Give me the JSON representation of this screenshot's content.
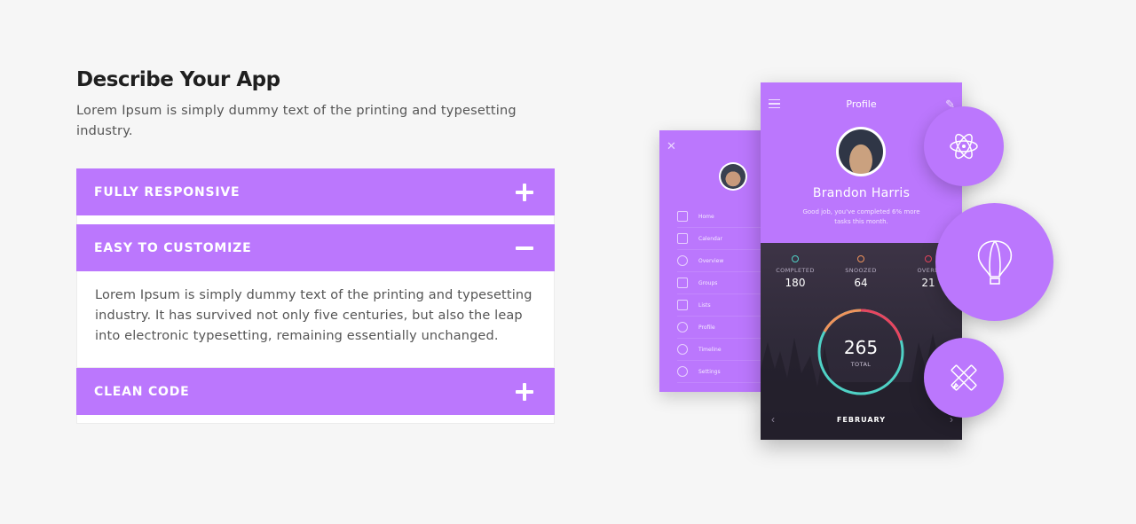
{
  "section": {
    "title": "Describe Your App",
    "description": "Lorem Ipsum is simply dummy text of the printing and typesetting industry."
  },
  "accordion": {
    "items": [
      {
        "label": "FULLY RESPONSIVE",
        "state": "collapsed"
      },
      {
        "label": "EASY TO CUSTOMIZE",
        "state": "expanded",
        "body": "Lorem Ipsum is simply dummy text of the printing and typesetting industry. It has survived not only five centuries, but also the leap into electronic typesetting, remaining essentially unchanged."
      },
      {
        "label": "CLEAN CODE",
        "state": "collapsed"
      }
    ]
  },
  "mockup": {
    "sidebar": {
      "items": [
        "Home",
        "Calendar",
        "Overview",
        "Groups",
        "Lists",
        "Profile",
        "Timeline",
        "Settings"
      ]
    },
    "profile": {
      "title": "Profile",
      "name": "Brandon Harris",
      "subtitle": "Good job, you've completed 6% more tasks this month."
    },
    "stats": [
      {
        "label": "COMPLETED",
        "value": "180",
        "color": "#4fd1c5"
      },
      {
        "label": "SNOOZED",
        "value": "64",
        "color": "#f0935b"
      },
      {
        "label": "OVERD",
        "value": "21",
        "color": "#e8455f"
      }
    ],
    "total": {
      "value": "265",
      "label": "TOTAL"
    },
    "month": "FEBRUARY"
  },
  "colors": {
    "accent": "#bb77fd",
    "background": "#f6f6f6"
  },
  "icons": [
    "plus-icon",
    "minus-icon",
    "atom-icon",
    "hot-air-balloon-icon",
    "pencil-ruler-icon"
  ]
}
